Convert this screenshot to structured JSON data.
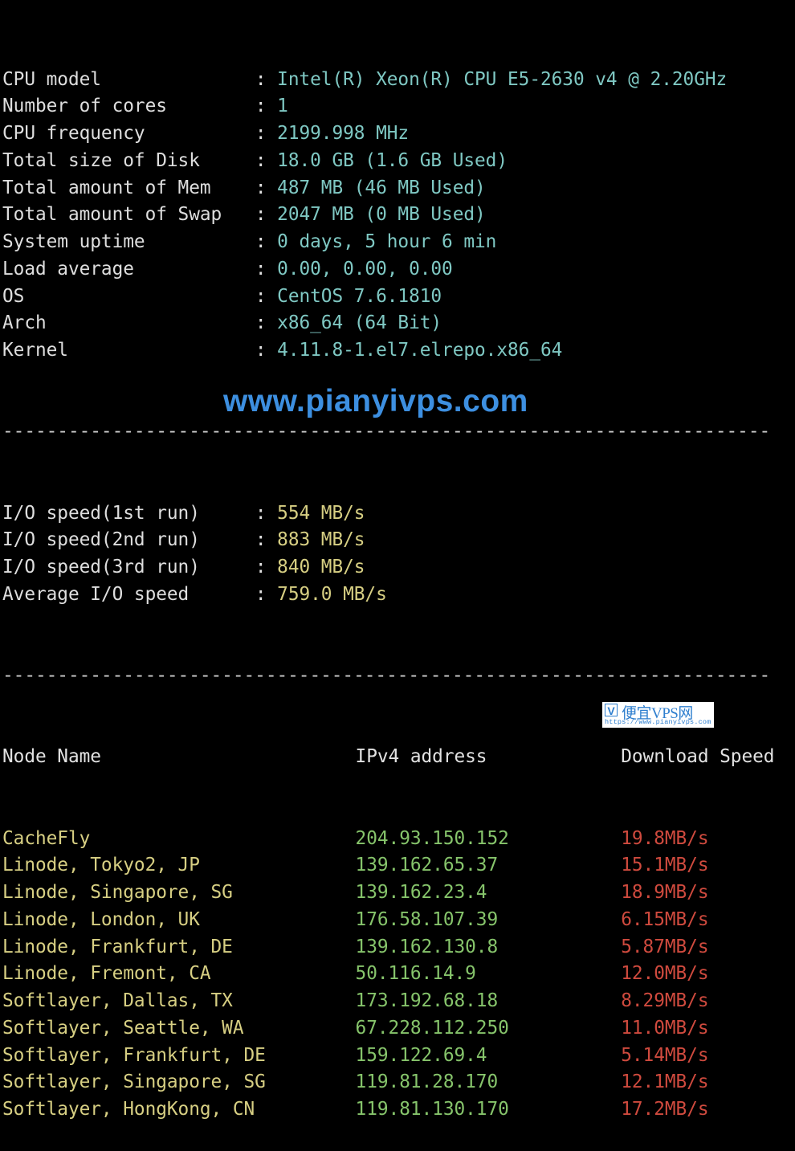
{
  "colors": {
    "background": "#000000",
    "label": "#dedede",
    "sysinfo_value": "#7fc8c3",
    "io_value": "#d7cf83",
    "node_name": "#d7cf83",
    "ip_address": "#86c46b",
    "download_speed": "#cf4a3e",
    "watermark": "#3d8fe0"
  },
  "system_info": [
    {
      "label": "CPU model",
      "value": "Intel(R) Xeon(R) CPU E5-2630 v4 @ 2.20GHz"
    },
    {
      "label": "Number of cores",
      "value": "1"
    },
    {
      "label": "CPU frequency",
      "value": "2199.998 MHz"
    },
    {
      "label": "Total size of Disk",
      "value": "18.0 GB (1.6 GB Used)"
    },
    {
      "label": "Total amount of Mem",
      "value": "487 MB (46 MB Used)"
    },
    {
      "label": "Total amount of Swap",
      "value": "2047 MB (0 MB Used)"
    },
    {
      "label": "System uptime",
      "value": "0 days, 5 hour 6 min"
    },
    {
      "label": "Load average",
      "value": "0.00, 0.00, 0.00"
    },
    {
      "label": "OS",
      "value": "CentOS 7.6.1810"
    },
    {
      "label": "Arch",
      "value": "x86_64 (64 Bit)"
    },
    {
      "label": "Kernel",
      "value": "4.11.8-1.el7.elrepo.x86_64"
    }
  ],
  "separator": "----------------------------------------------------------------------",
  "colon": ": ",
  "io_tests": [
    {
      "label": "I/O speed(1st run)",
      "value": "554 MB/s"
    },
    {
      "label": "I/O speed(2nd run)",
      "value": "883 MB/s"
    },
    {
      "label": "I/O speed(3rd run)",
      "value": "840 MB/s"
    },
    {
      "label": "Average I/O speed",
      "value": "759.0 MB/s"
    }
  ],
  "speed_table": {
    "headers": [
      "Node Name",
      "IPv4 address",
      "Download Speed"
    ],
    "rows": [
      {
        "node": "CacheFly",
        "ip": "204.93.150.152",
        "speed": "19.8MB/s"
      },
      {
        "node": "Linode, Tokyo2, JP",
        "ip": "139.162.65.37",
        "speed": "15.1MB/s"
      },
      {
        "node": "Linode, Singapore, SG",
        "ip": "139.162.23.4",
        "speed": "18.9MB/s"
      },
      {
        "node": "Linode, London, UK",
        "ip": "176.58.107.39",
        "speed": "6.15MB/s"
      },
      {
        "node": "Linode, Frankfurt, DE",
        "ip": "139.162.130.8",
        "speed": "5.87MB/s"
      },
      {
        "node": "Linode, Fremont, CA",
        "ip": "50.116.14.9",
        "speed": "12.0MB/s"
      },
      {
        "node": "Softlayer, Dallas, TX",
        "ip": "173.192.68.18",
        "speed": "8.29MB/s"
      },
      {
        "node": "Softlayer, Seattle, WA",
        "ip": "67.228.112.250",
        "speed": "11.0MB/s"
      },
      {
        "node": "Softlayer, Frankfurt, DE",
        "ip": "159.122.69.4",
        "speed": "5.14MB/s"
      },
      {
        "node": "Softlayer, Singapore, SG",
        "ip": "119.81.28.170",
        "speed": "12.1MB/s"
      },
      {
        "node": "Softlayer, HongKong, CN",
        "ip": "119.81.130.170",
        "speed": "17.2MB/s"
      }
    ]
  },
  "watermark": {
    "text": "www.pianyivps.com"
  },
  "badge": {
    "logo": "V",
    "title": "便宜VPS网",
    "url": "https://www.pianyivps.com"
  }
}
